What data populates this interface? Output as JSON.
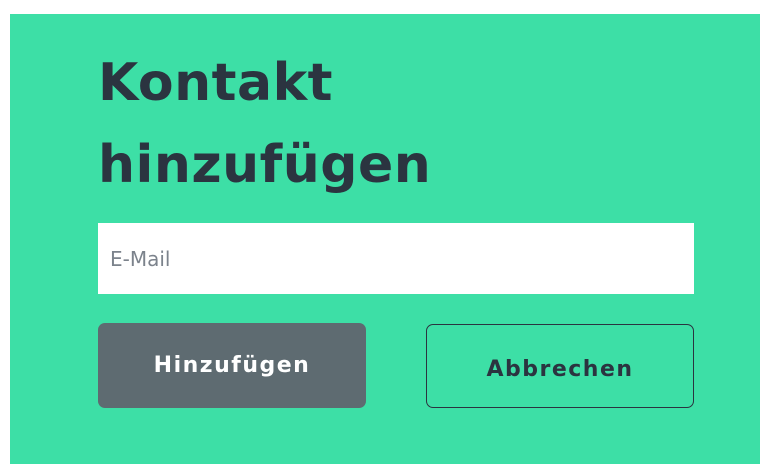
{
  "dialog": {
    "title": "Kontakt\nhinzufügen",
    "email_placeholder": "E-Mail",
    "email_value": "",
    "add_label": "Hinzufügen",
    "cancel_label": "Abbrechen"
  },
  "colors": {
    "panel_background": "#3ddfa6",
    "title_text": "#2b3440",
    "primary_button": "#5e6b71",
    "primary_button_text": "#ffffff",
    "secondary_button_border": "#2b3440"
  }
}
